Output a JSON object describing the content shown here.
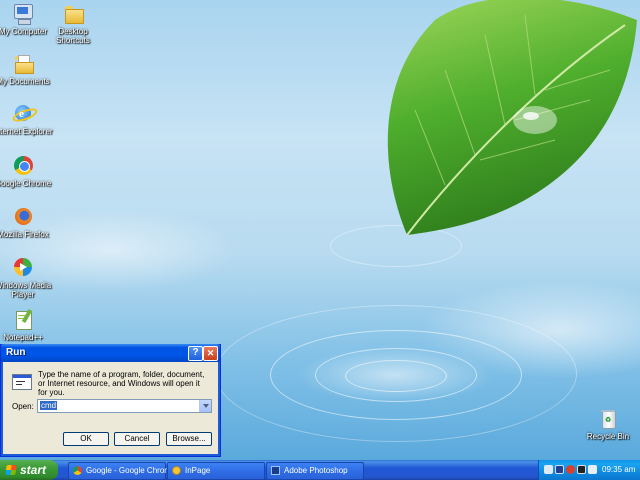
{
  "desktop": {
    "icons": [
      {
        "label": "My Computer",
        "icon": "computer-icon"
      },
      {
        "label": "Desktop Shortcuts",
        "icon": "folder-icon"
      },
      {
        "label": "My Documents",
        "icon": "documents-folder-icon"
      },
      {
        "label": "Internet Explorer",
        "icon": "internet-explorer-icon"
      },
      {
        "label": "Google Chrome",
        "icon": "chrome-icon"
      },
      {
        "label": "Mozilla Firefox",
        "icon": "firefox-icon"
      },
      {
        "label": "Windows Media Player",
        "icon": "media-player-icon"
      },
      {
        "label": "Notepad++",
        "icon": "notepad-icon"
      },
      {
        "label": "Recycle Bin",
        "icon": "recycle-bin-icon"
      }
    ]
  },
  "run_dialog": {
    "title": "Run",
    "help_label": "?",
    "close_label": "✕",
    "description": "Type the name of a program, folder, document, or Internet resource, and Windows will open it for you.",
    "open_label": "Open:",
    "open_value": "cmd",
    "ok_label": "OK",
    "cancel_label": "Cancel",
    "browse_label": "Browse..."
  },
  "taskbar": {
    "start_label": "start",
    "tasks": [
      {
        "label": "Google - Google Chrome",
        "icon": "chrome-icon"
      },
      {
        "label": "InPage",
        "icon": "inpage-icon"
      },
      {
        "label": "Adobe Photoshop",
        "icon": "photoshop-icon"
      }
    ],
    "clock": "09:35 am"
  },
  "colors": {
    "taskbar_blue": "#2456cf",
    "start_green": "#3c9a37",
    "dialog_face": "#ece9d8",
    "title_blue": "#0054e3"
  }
}
